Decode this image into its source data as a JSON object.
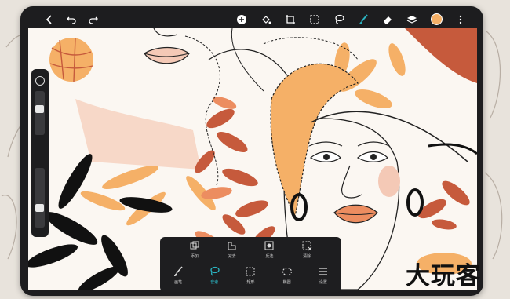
{
  "toolbar": {
    "left_icons": [
      "back-icon",
      "undo-icon",
      "redo-icon"
    ],
    "right_icons": [
      "add-icon",
      "fill-icon",
      "crop-icon",
      "selection-icon",
      "lasso-icon",
      "brush-icon",
      "eraser-icon",
      "layers-icon",
      "color-swatch",
      "more-icon"
    ],
    "current_color": "#f5b067"
  },
  "sidebar": {
    "brush_size_level": 0.2,
    "opacity_level": 0.6
  },
  "selection_panel": {
    "row1": [
      {
        "icon": "add-selection-icon",
        "label": "添加"
      },
      {
        "icon": "subtract-selection-icon",
        "label": "减去"
      },
      {
        "icon": "invert-selection-icon",
        "label": "反选"
      },
      {
        "icon": "clear-selection-icon",
        "label": "清除"
      }
    ],
    "row2": [
      {
        "icon": "brush-select-icon",
        "label": "画笔"
      },
      {
        "icon": "lasso-select-icon",
        "label": "套索",
        "active": true
      },
      {
        "icon": "rect-select-icon",
        "label": "矩形"
      },
      {
        "icon": "ellipse-select-icon",
        "label": "椭圆"
      },
      {
        "icon": "settings-icon",
        "label": "设置"
      }
    ]
  },
  "watermark": "大玩客",
  "colors": {
    "accent": "#2bb3c0",
    "orange": "#f5b067",
    "rust": "#c65a3c",
    "peach": "#f4c9b6"
  }
}
